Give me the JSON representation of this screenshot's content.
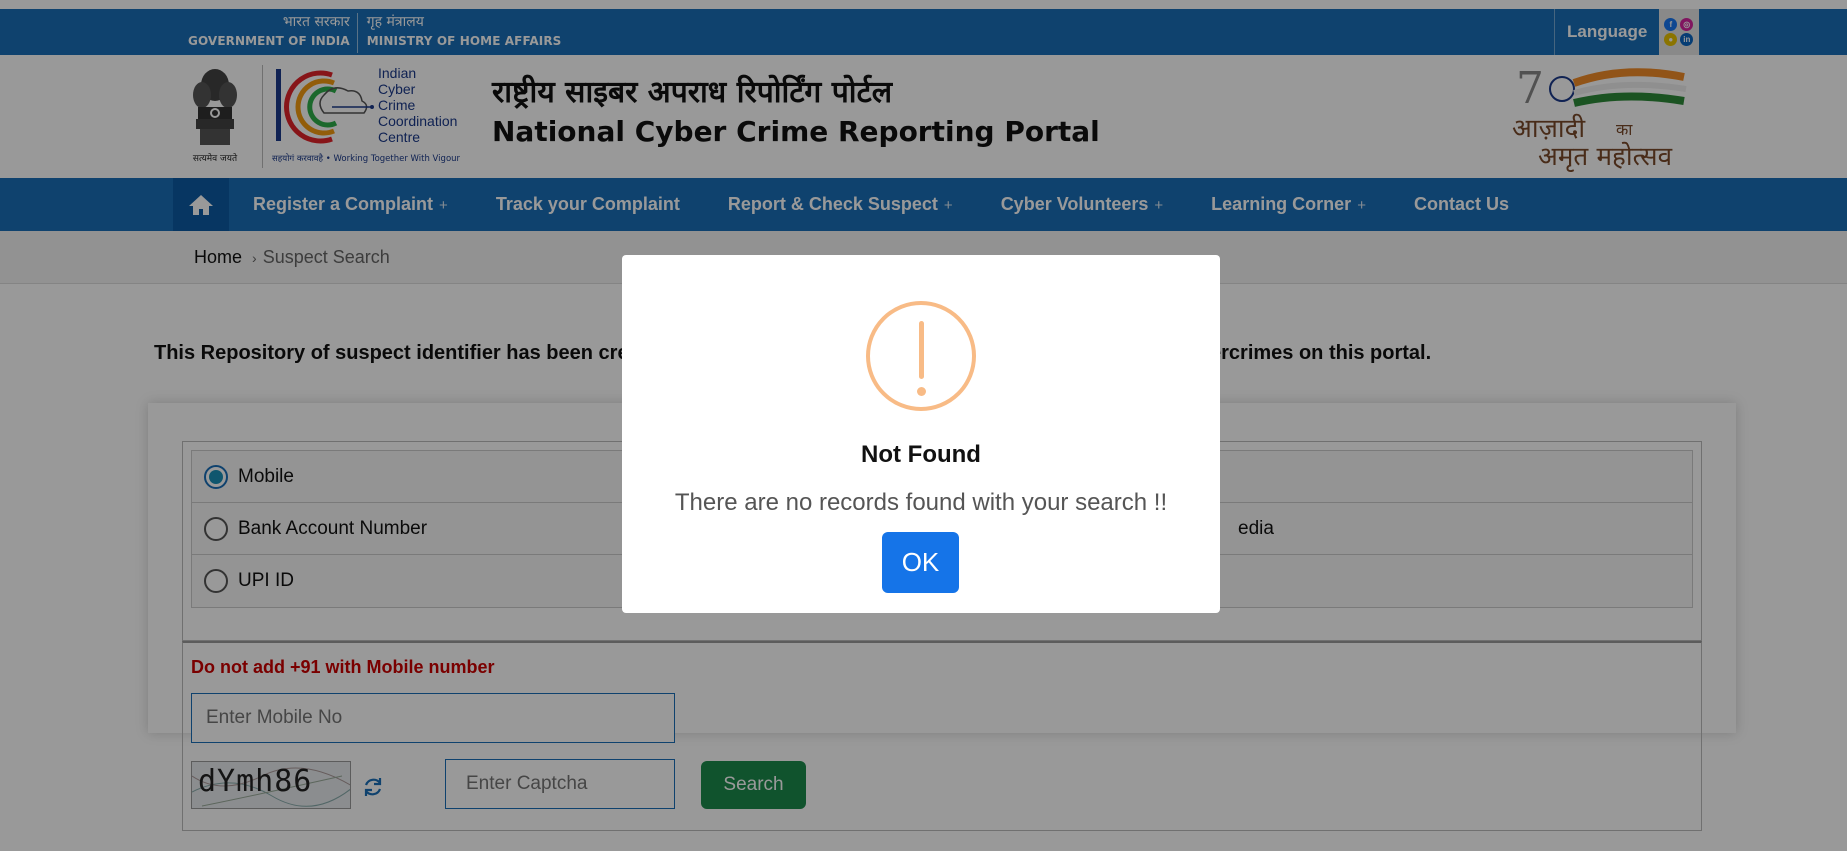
{
  "gov": {
    "hi_1": "भारत सरकार",
    "en_1": "GOVERNMENT OF INDIA",
    "hi_2": "गृह मंत्रालय",
    "en_2": "MINISTRY OF HOME AFFAIRS",
    "language": "Language"
  },
  "header": {
    "emblem_caption": "सत्यमेव जयते",
    "i4c_lines": [
      "Indian",
      "Cyber",
      "Crime",
      "Coordination",
      "Centre"
    ],
    "i4c_tag": "सहयोगं करवावहै  •  Working Together With Vigour",
    "title_hi": "राष्ट्रीय साइबर अपराध रिपोर्टिंग पोर्टल",
    "title_en": "National Cyber Crime Reporting Portal",
    "azadi_hi_1": "आज़ादी",
    "azadi_hi_small": "का",
    "azadi_hi_2": "अमृत महोत्सव"
  },
  "nav": {
    "items": [
      {
        "label": "Register a Complaint",
        "plus": "+"
      },
      {
        "label": "Track your Complaint",
        "plus": ""
      },
      {
        "label": "Report & Check Suspect",
        "plus": "+"
      },
      {
        "label": "Cyber Volunteers",
        "plus": "+"
      },
      {
        "label": "Learning Corner",
        "plus": "+"
      },
      {
        "label": "Contact Us",
        "plus": ""
      }
    ]
  },
  "breadcrumb": {
    "home": "Home",
    "sep": "›",
    "current": "Suspect Search"
  },
  "main": {
    "intro_start": "This Repository of suspect identifier has been crea",
    "intro_end": "ercrimes on this portal.",
    "options": [
      {
        "label": "Mobile",
        "selected": true,
        "right": ""
      },
      {
        "label": "Bank Account Number",
        "selected": false,
        "right": "edia"
      },
      {
        "label": "UPI ID",
        "selected": false,
        "right": ""
      }
    ],
    "warning": "Do not add +91 with Mobile number",
    "mobile_placeholder": "Enter Mobile No",
    "captcha_text": "dYmh86",
    "captcha_placeholder": "Enter Captcha",
    "search_label": "Search"
  },
  "modal": {
    "title": "Not Found",
    "text": "There are no records found with your search !!",
    "ok_label": "OK",
    "icon_color": "#f8bb86",
    "button_color": "#1574e8"
  },
  "colors": {
    "brand_blue": "#1a6fb8",
    "search_green": "#1c8a4c",
    "warning_red": "#cc0000"
  }
}
